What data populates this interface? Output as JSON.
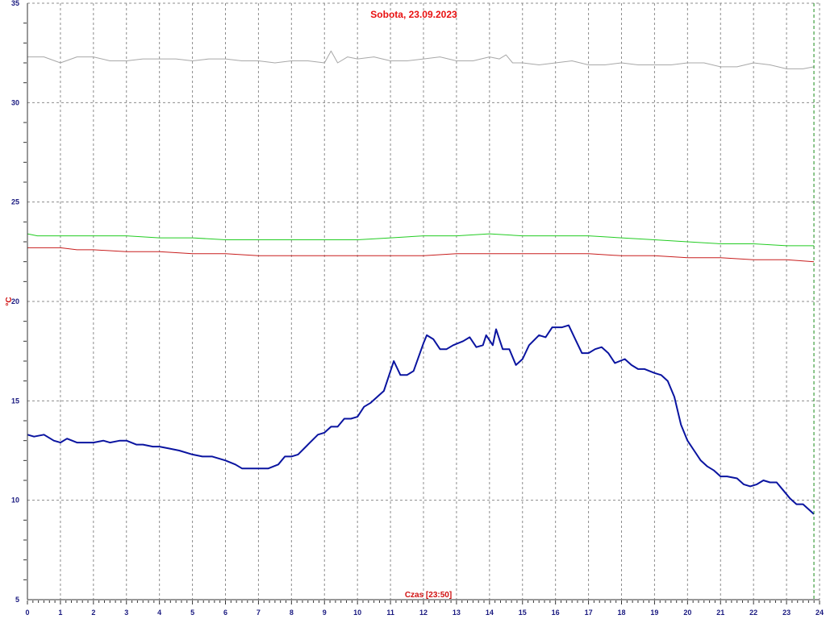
{
  "chart_data": {
    "type": "line",
    "title": "Sobota, 23.09.2023",
    "xlabel": "Czas [23:50]",
    "ylabel": "°C",
    "xlim": [
      0,
      24
    ],
    "ylim": [
      5,
      35
    ],
    "x_ticks": [
      "0",
      "1",
      "2",
      "3",
      "4",
      "5",
      "6",
      "7",
      "8",
      "9",
      "10",
      "11",
      "12",
      "13",
      "14",
      "15",
      "16",
      "17",
      "18",
      "19",
      "20",
      "21",
      "22",
      "23",
      "24"
    ],
    "y_ticks": [
      "5",
      "10",
      "15",
      "20",
      "25",
      "30",
      "35"
    ],
    "grid": true,
    "legend": "none",
    "current_time_marker": 23.83,
    "colors": {
      "gray": "#a8a8a8",
      "green": "#22cc22",
      "red": "#c81e1e",
      "blue": "#0a14a0",
      "grid": "#8c8c8c",
      "marker": "#1a8c1a"
    },
    "series": [
      {
        "color": "#a8a8a8",
        "points": [
          [
            0,
            32.3
          ],
          [
            0.5,
            32.3
          ],
          [
            1,
            32.0
          ],
          [
            1.5,
            32.3
          ],
          [
            2,
            32.3
          ],
          [
            2.5,
            32.1
          ],
          [
            3,
            32.1
          ],
          [
            3.5,
            32.2
          ],
          [
            4,
            32.2
          ],
          [
            4.5,
            32.2
          ],
          [
            5,
            32.1
          ],
          [
            5.5,
            32.2
          ],
          [
            6,
            32.2
          ],
          [
            6.5,
            32.1
          ],
          [
            7,
            32.1
          ],
          [
            7.5,
            32.0
          ],
          [
            8,
            32.1
          ],
          [
            8.5,
            32.1
          ],
          [
            9,
            32.0
          ],
          [
            9.2,
            32.6
          ],
          [
            9.4,
            32.0
          ],
          [
            9.7,
            32.3
          ],
          [
            10,
            32.2
          ],
          [
            10.5,
            32.3
          ],
          [
            11,
            32.1
          ],
          [
            11.5,
            32.1
          ],
          [
            12,
            32.2
          ],
          [
            12.5,
            32.3
          ],
          [
            13,
            32.1
          ],
          [
            13.5,
            32.1
          ],
          [
            14,
            32.3
          ],
          [
            14.3,
            32.2
          ],
          [
            14.5,
            32.4
          ],
          [
            14.7,
            32.0
          ],
          [
            15,
            32.0
          ],
          [
            15.5,
            31.9
          ],
          [
            16,
            32.0
          ],
          [
            16.5,
            32.1
          ],
          [
            17,
            31.9
          ],
          [
            17.5,
            31.9
          ],
          [
            18,
            32.0
          ],
          [
            18.5,
            31.9
          ],
          [
            19,
            31.9
          ],
          [
            19.5,
            31.9
          ],
          [
            20,
            32.0
          ],
          [
            20.5,
            32.0
          ],
          [
            21,
            31.8
          ],
          [
            21.5,
            31.8
          ],
          [
            22,
            32.0
          ],
          [
            22.5,
            31.9
          ],
          [
            23,
            31.7
          ],
          [
            23.5,
            31.7
          ],
          [
            23.83,
            31.8
          ]
        ]
      },
      {
        "color": "#22cc22",
        "points": [
          [
            0,
            23.4
          ],
          [
            0.3,
            23.3
          ],
          [
            1,
            23.3
          ],
          [
            2,
            23.3
          ],
          [
            3,
            23.3
          ],
          [
            4,
            23.2
          ],
          [
            5,
            23.2
          ],
          [
            6,
            23.1
          ],
          [
            7,
            23.1
          ],
          [
            8,
            23.1
          ],
          [
            9,
            23.1
          ],
          [
            10,
            23.1
          ],
          [
            11,
            23.2
          ],
          [
            12,
            23.3
          ],
          [
            13,
            23.3
          ],
          [
            14,
            23.4
          ],
          [
            15,
            23.3
          ],
          [
            16,
            23.3
          ],
          [
            17,
            23.3
          ],
          [
            18,
            23.2
          ],
          [
            19,
            23.1
          ],
          [
            20,
            23.0
          ],
          [
            21,
            22.9
          ],
          [
            22,
            22.9
          ],
          [
            23,
            22.8
          ],
          [
            23.83,
            22.8
          ]
        ]
      },
      {
        "color": "#c81e1e",
        "points": [
          [
            0,
            22.7
          ],
          [
            1,
            22.7
          ],
          [
            1.5,
            22.6
          ],
          [
            2,
            22.6
          ],
          [
            3,
            22.5
          ],
          [
            4,
            22.5
          ],
          [
            5,
            22.4
          ],
          [
            6,
            22.4
          ],
          [
            7,
            22.3
          ],
          [
            8,
            22.3
          ],
          [
            9,
            22.3
          ],
          [
            10,
            22.3
          ],
          [
            11,
            22.3
          ],
          [
            12,
            22.3
          ],
          [
            13,
            22.4
          ],
          [
            14,
            22.4
          ],
          [
            15,
            22.4
          ],
          [
            16,
            22.4
          ],
          [
            17,
            22.4
          ],
          [
            18,
            22.3
          ],
          [
            19,
            22.3
          ],
          [
            20,
            22.2
          ],
          [
            21,
            22.2
          ],
          [
            22,
            22.1
          ],
          [
            23,
            22.1
          ],
          [
            23.83,
            22.0
          ]
        ]
      },
      {
        "color": "#0a14a0",
        "points": [
          [
            0,
            13.3
          ],
          [
            0.2,
            13.2
          ],
          [
            0.5,
            13.3
          ],
          [
            0.8,
            13.0
          ],
          [
            1,
            12.9
          ],
          [
            1.2,
            13.1
          ],
          [
            1.5,
            12.9
          ],
          [
            2,
            12.9
          ],
          [
            2.3,
            13.0
          ],
          [
            2.5,
            12.9
          ],
          [
            2.8,
            13.0
          ],
          [
            3,
            13.0
          ],
          [
            3.3,
            12.8
          ],
          [
            3.5,
            12.8
          ],
          [
            3.8,
            12.7
          ],
          [
            4,
            12.7
          ],
          [
            4.3,
            12.6
          ],
          [
            4.6,
            12.5
          ],
          [
            5,
            12.3
          ],
          [
            5.3,
            12.2
          ],
          [
            5.6,
            12.2
          ],
          [
            6,
            12.0
          ],
          [
            6.3,
            11.8
          ],
          [
            6.5,
            11.6
          ],
          [
            7,
            11.6
          ],
          [
            7.3,
            11.6
          ],
          [
            7.6,
            11.8
          ],
          [
            7.8,
            12.2
          ],
          [
            8,
            12.2
          ],
          [
            8.2,
            12.3
          ],
          [
            8.5,
            12.8
          ],
          [
            8.8,
            13.3
          ],
          [
            9,
            13.4
          ],
          [
            9.2,
            13.7
          ],
          [
            9.4,
            13.7
          ],
          [
            9.6,
            14.1
          ],
          [
            9.8,
            14.1
          ],
          [
            10,
            14.2
          ],
          [
            10.2,
            14.7
          ],
          [
            10.4,
            14.9
          ],
          [
            10.6,
            15.2
          ],
          [
            10.8,
            15.5
          ],
          [
            11,
            16.5
          ],
          [
            11.1,
            17.0
          ],
          [
            11.3,
            16.3
          ],
          [
            11.5,
            16.3
          ],
          [
            11.7,
            16.5
          ],
          [
            12,
            17.9
          ],
          [
            12.1,
            18.3
          ],
          [
            12.3,
            18.1
          ],
          [
            12.5,
            17.6
          ],
          [
            12.7,
            17.6
          ],
          [
            12.9,
            17.8
          ],
          [
            13.2,
            18.0
          ],
          [
            13.4,
            18.2
          ],
          [
            13.6,
            17.7
          ],
          [
            13.8,
            17.8
          ],
          [
            13.9,
            18.3
          ],
          [
            14.1,
            17.8
          ],
          [
            14.2,
            18.6
          ],
          [
            14.4,
            17.6
          ],
          [
            14.6,
            17.6
          ],
          [
            14.8,
            16.8
          ],
          [
            15,
            17.1
          ],
          [
            15.2,
            17.8
          ],
          [
            15.5,
            18.3
          ],
          [
            15.7,
            18.2
          ],
          [
            15.9,
            18.7
          ],
          [
            16.2,
            18.7
          ],
          [
            16.4,
            18.8
          ],
          [
            16.6,
            18.1
          ],
          [
            16.8,
            17.4
          ],
          [
            17,
            17.4
          ],
          [
            17.2,
            17.6
          ],
          [
            17.4,
            17.7
          ],
          [
            17.6,
            17.4
          ],
          [
            17.8,
            16.9
          ],
          [
            18.1,
            17.1
          ],
          [
            18.3,
            16.8
          ],
          [
            18.5,
            16.6
          ],
          [
            18.7,
            16.6
          ],
          [
            19,
            16.4
          ],
          [
            19.2,
            16.3
          ],
          [
            19.4,
            16.0
          ],
          [
            19.6,
            15.2
          ],
          [
            19.8,
            13.8
          ],
          [
            20,
            13.0
          ],
          [
            20.2,
            12.5
          ],
          [
            20.4,
            12.0
          ],
          [
            20.6,
            11.7
          ],
          [
            20.8,
            11.5
          ],
          [
            21,
            11.2
          ],
          [
            21.2,
            11.2
          ],
          [
            21.5,
            11.1
          ],
          [
            21.7,
            10.8
          ],
          [
            21.9,
            10.7
          ],
          [
            22.1,
            10.8
          ],
          [
            22.3,
            11.0
          ],
          [
            22.5,
            10.9
          ],
          [
            22.7,
            10.9
          ],
          [
            22.9,
            10.5
          ],
          [
            23.1,
            10.1
          ],
          [
            23.3,
            9.8
          ],
          [
            23.5,
            9.8
          ],
          [
            23.7,
            9.5
          ],
          [
            23.83,
            9.3
          ]
        ]
      }
    ]
  }
}
